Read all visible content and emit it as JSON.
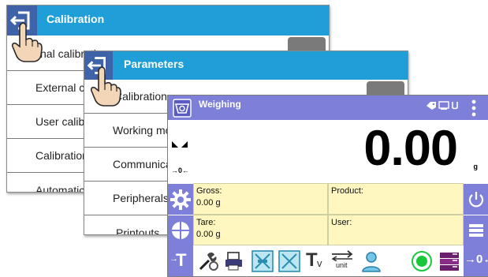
{
  "calibration_window": {
    "title": "Calibration",
    "items": [
      "Internal calibration",
      "External calibration",
      "User calibration",
      "Calibration report",
      "Automatic calibration"
    ]
  },
  "parameters_window": {
    "title": "Parameters",
    "items": [
      "Calibration",
      "Working modes",
      "Communication",
      "Peripherals",
      "Printouts"
    ]
  },
  "weighing_window": {
    "title": "Weighing",
    "status_icons": [
      "tag-icon",
      "printer-icon",
      "usb-icon"
    ],
    "value": "0.00",
    "unit": "g",
    "zero_marker": "→0←",
    "info": {
      "gross_label": "Gross:",
      "gross_value": "0.00 g",
      "product_label": "Product:",
      "tare_label": "Tare:",
      "tare_value": "0.00 g",
      "user_label": "User:"
    },
    "bottom_icons": [
      "tare-icon",
      "tools-icon",
      "printer-settings-icon",
      "stable-icon",
      "unstable-icon",
      "text-icon",
      "unit-change-icon",
      "user-icon",
      "status-ok-icon",
      "database-icon",
      "zero-icon"
    ],
    "bottom_labels": {
      "tare": "T",
      "text": "T",
      "unit": "unit"
    },
    "colors": {
      "header": "#7d7fd9",
      "info_bg": "#fff7bf",
      "accent_blue": "#1f9ed8",
      "status_green": "#19c93b"
    }
  }
}
